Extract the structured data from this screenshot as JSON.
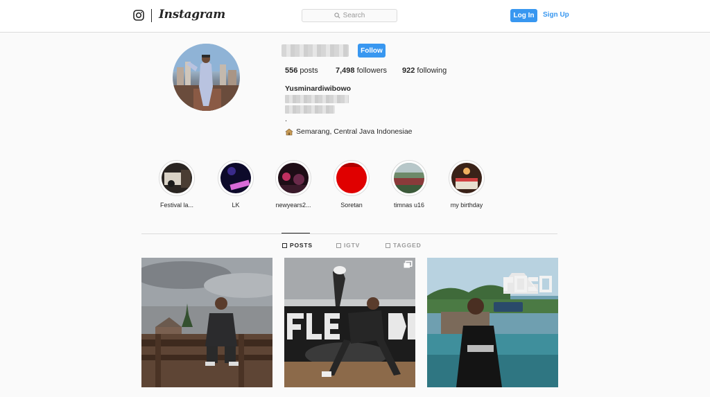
{
  "nav": {
    "wordmark": "Instagram",
    "search_placeholder": "Search",
    "login_label": "Log In",
    "signup_label": "Sign Up"
  },
  "profile": {
    "follow_label": "Follow",
    "stats": [
      {
        "value": "556",
        "label": "posts"
      },
      {
        "value": "7,498",
        "label": "followers"
      },
      {
        "value": "922",
        "label": "following"
      }
    ],
    "full_name": "Yusminardiwibowo",
    "bio_dot": ".",
    "location": "Semarang, Central Java Indonesiae"
  },
  "highlights": [
    {
      "label": "Festival la..."
    },
    {
      "label": "LK"
    },
    {
      "label": "newyears2..."
    },
    {
      "label": "Soretan"
    },
    {
      "label": "timnas u16"
    },
    {
      "label": "my birthday"
    }
  ],
  "tabs": [
    {
      "label": "POSTS",
      "active": true
    },
    {
      "label": "IGTV",
      "active": false
    },
    {
      "label": "TAGGED",
      "active": false
    }
  ],
  "colors": {
    "accent": "#3897f0",
    "border": "#dbdbdb",
    "background": "#fafafa"
  },
  "icons": {
    "logo": "instagram-camera-icon",
    "search": "search-icon",
    "location": "house-icon",
    "multi_post": "multiple-images-icon"
  }
}
